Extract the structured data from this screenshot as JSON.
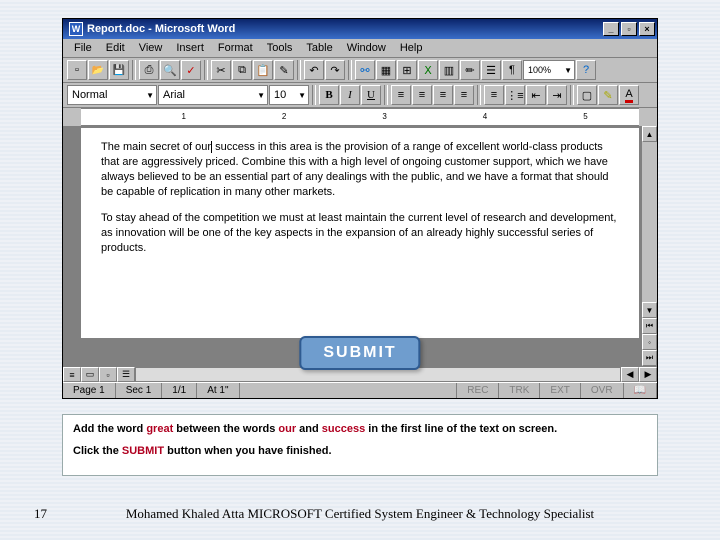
{
  "title": "Report.doc - Microsoft Word",
  "menu": [
    "File",
    "Edit",
    "View",
    "Insert",
    "Format",
    "Tools",
    "Table",
    "Window",
    "Help"
  ],
  "format_toolbar": {
    "style": "Normal",
    "font": "Arial",
    "size": "10",
    "b": "B",
    "i": "I",
    "u": "U",
    "zoom": "100%"
  },
  "ruler_marks": [
    "1",
    "2",
    "3",
    "4",
    "5"
  ],
  "doc": {
    "p1_a": "The main secret of our",
    "p1_b": " success in this area is the provision of a range of excellent world-class products that are aggressively priced. Combine this with a high level of ongoing customer support, which we have always believed to be an essential part of any dealings with the public, and we have a format that should be capable of replication in many other markets.",
    "p2": "To stay ahead of the competition we must at least maintain the current level of research and development, as innovation will be one of the key aspects in the expansion of an already highly successful series of products."
  },
  "submit_label": "SUBMIT",
  "status": {
    "page": "Page 1",
    "sec": "Sec 1",
    "of": "1/1",
    "at": "At 1\"",
    "rec": "REC",
    "trk": "TRK",
    "ext": "EXT",
    "ovr": "OVR"
  },
  "instructions": {
    "line1_a": "Add the word ",
    "line1_w1": "great",
    "line1_b": " between the words ",
    "line1_w2": "our",
    "line1_c": " and ",
    "line1_w3": "success",
    "line1_d": " in the first line of the text on screen.",
    "line2_a": "Click the ",
    "line2_w": "SUBMIT",
    "line2_b": " button when you have finished."
  },
  "footer": "Mohamed Khaled Atta MICROSOFT Certified System Engineer & Technology Specialist",
  "slide_num": "17"
}
